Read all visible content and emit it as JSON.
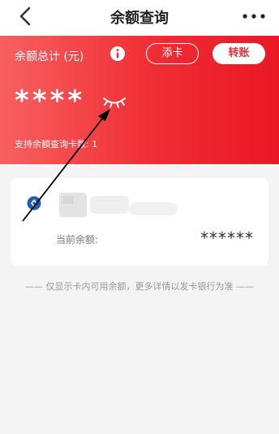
{
  "nav": {
    "title": "余额查询"
  },
  "summary": {
    "label": "余额总计 (元)",
    "add_label": "添卡",
    "transfer_label": "转账",
    "amount_masked": "****",
    "card_count_text": "支持余额查询卡数: 1"
  },
  "card": {
    "balance_label": "当前余额:",
    "balance_value": "******"
  },
  "footnote": "—— 仅显示卡内可用余额，更多详情以发卡银行为准 ——",
  "icons": {
    "back": "chevron-left-icon",
    "more": "more-dots-icon",
    "info": "info-icon",
    "eye": "eye-closed-icon",
    "bank": "bank-logo-icon"
  },
  "colors": {
    "accent": "#ea1825",
    "gradient_start": "#f86060",
    "card_bg": "#ffffff",
    "page_bg": "#f4f4f4"
  }
}
